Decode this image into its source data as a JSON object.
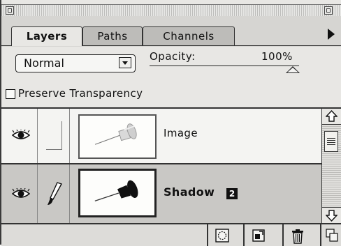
{
  "tabs": [
    {
      "label": "Layers",
      "active": true
    },
    {
      "label": "Paths",
      "active": false
    },
    {
      "label": "Channels",
      "active": false
    }
  ],
  "options": {
    "blend_mode": "Normal",
    "opacity_label": "Opacity:",
    "opacity_value": "100%",
    "opacity_level": 1.0
  },
  "preserve_transparency": {
    "label": "Preserve Transparency",
    "checked": false
  },
  "layers": [
    {
      "name": "Image",
      "visible": true,
      "selected": false,
      "icon": "pushpin-icon"
    },
    {
      "name": "Shadow",
      "badge": "2",
      "visible": true,
      "selected": true,
      "icon": "pushpin-shadow-icon"
    }
  ],
  "icons": {
    "eye": "eye-icon",
    "brush": "paintbrush-icon",
    "menu": "palette-menu-arrow-icon",
    "new_layer_mask": "layer-mask-icon",
    "new_layer": "new-layer-icon",
    "trash": "trash-icon"
  },
  "colors": {
    "selected_row": "#c9c8c5",
    "panel": "#e8e7e4"
  }
}
